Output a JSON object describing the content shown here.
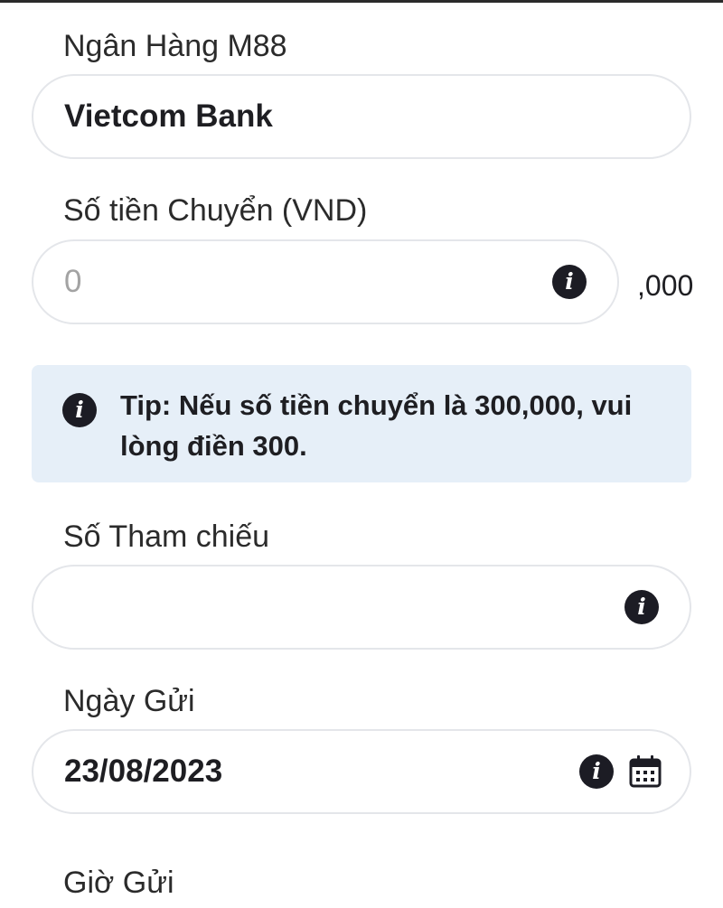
{
  "bank": {
    "label": "Ngân Hàng M88",
    "value": "Vietcom Bank"
  },
  "amount": {
    "label": "Số tiền Chuyển (VND)",
    "placeholder": "0",
    "suffix": ",000"
  },
  "tip": {
    "text": "Tip: Nếu số tiền chuyển là 300,000, vui lòng điền 300."
  },
  "reference": {
    "label": "Số Tham chiếu",
    "value": ""
  },
  "deposit_date": {
    "label": "Ngày Gửi",
    "value": "23/08/2023"
  },
  "deposit_time": {
    "label": "Giờ Gửi"
  },
  "icons": {
    "info": "info-icon",
    "calendar": "calendar-icon"
  },
  "colors": {
    "field_border": "#e4e6ea",
    "tip_background": "#e6eff8",
    "icon_dark": "#1c1c24",
    "text": "#2b2b2b",
    "placeholder": "#a3a3a3"
  }
}
